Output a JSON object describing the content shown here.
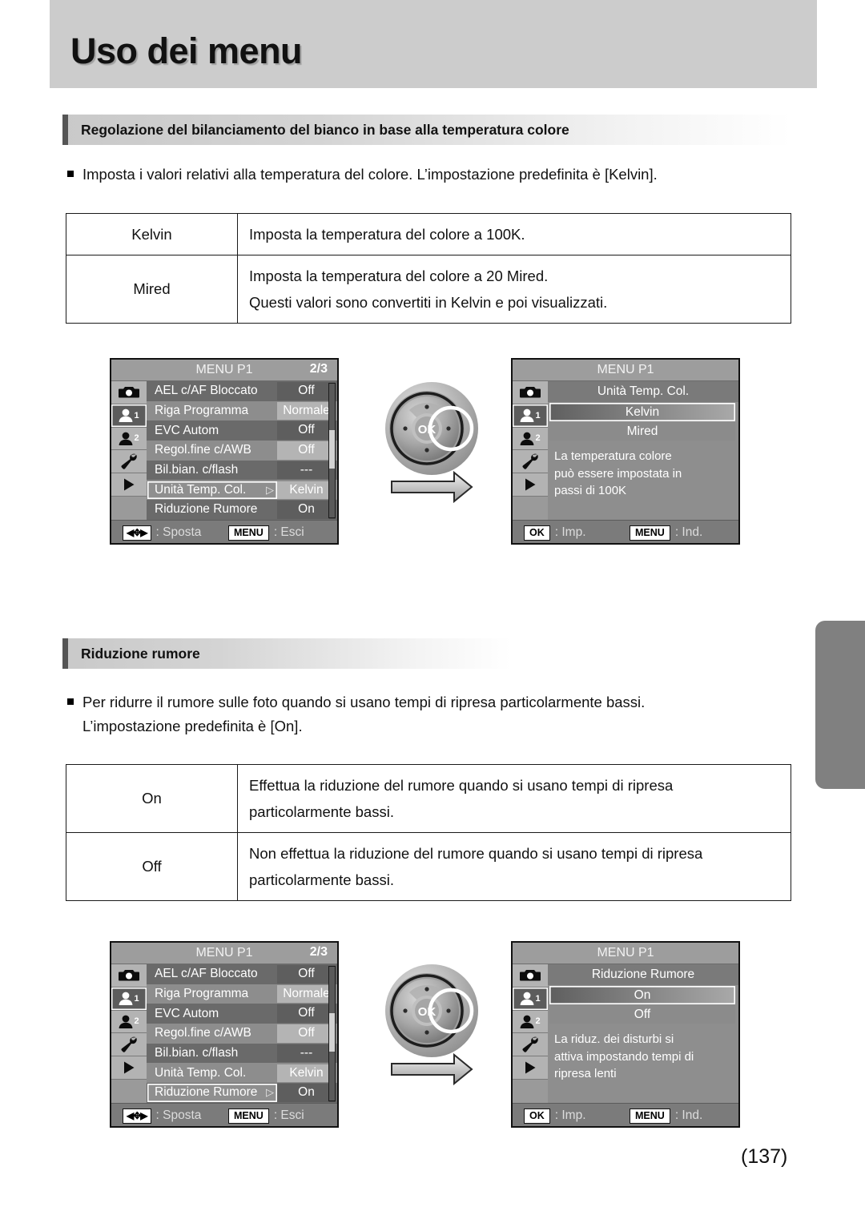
{
  "page": {
    "title": "Uso dei menu",
    "number": "(137)"
  },
  "sections": [
    {
      "heading": "Regolazione del bilanciamento del bianco in base alla temperatura colore",
      "bullet": "Imposta i valori relativi alla temperatura del colore. L’impostazione predefinita è [Kelvin].",
      "table": {
        "rows": [
          {
            "key": "Kelvin",
            "lines": [
              "Imposta la temperatura del colore a 100K."
            ]
          },
          {
            "key": "Mired",
            "lines": [
              "Imposta la temperatura del colore a 20 Mired.",
              "Questi valori sono convertiti in Kelvin e poi visualizzati."
            ]
          }
        ]
      }
    },
    {
      "heading": "Riduzione rumore",
      "bullet_lines": [
        "Per ridurre il rumore sulle foto quando si usano tempi di ripresa particolarmente bassi.",
        "L’impostazione predefinita è [On]."
      ],
      "table": {
        "rows": [
          {
            "key": "On",
            "lines": [
              "Effettua la riduzione del rumore quando si usano tempi di ripresa",
              "particolarmente bassi."
            ]
          },
          {
            "key": "Off",
            "lines": [
              "Non effettua la riduzione del rumore quando si usano tempi di ripresa",
              "particolarmente bassi."
            ]
          }
        ]
      }
    }
  ],
  "lcd_tabs": [
    {
      "icon": "camera-icon",
      "badge": ""
    },
    {
      "icon": "person-icon",
      "badge": "1"
    },
    {
      "icon": "person-icon",
      "badge": "2"
    },
    {
      "icon": "wrench-icon",
      "badge": ""
    },
    {
      "icon": "play-icon",
      "badge": ""
    }
  ],
  "screens": {
    "menu_wb": {
      "title": "MENU P1",
      "page_indicator": "2/3",
      "rows": [
        {
          "label": "AEL c/AF Bloccato",
          "value": "Off",
          "chip": "dark"
        },
        {
          "label": "Riga Programma",
          "value": "Normale",
          "chip": "light"
        },
        {
          "label": "EVC Autom",
          "value": "Off",
          "chip": "dark"
        },
        {
          "label": "Regol.fine c/AWB",
          "value": "Off",
          "chip": "light"
        },
        {
          "label": "Bil.bian. c/flash",
          "value": "---",
          "chip": "dark"
        },
        {
          "label": "Unità Temp. Col.",
          "value": "Kelvin",
          "chip": "light",
          "selected": true
        },
        {
          "label": "Riduzione Rumore",
          "value": "On",
          "chip": "dark"
        }
      ],
      "footer": {
        "key1": "◀✥▶",
        "text1": ": Sposta",
        "key2": "MENU",
        "text2": ": Esci"
      }
    },
    "opt_wb": {
      "title": "MENU P1",
      "option_title": "Unità Temp. Col.",
      "options": [
        {
          "label": "Kelvin",
          "selected": true
        },
        {
          "label": "Mired",
          "selected": false
        }
      ],
      "description": [
        "La temperatura colore",
        "può essere impostata in",
        "passi di 100K"
      ],
      "footer": {
        "key1": "OK",
        "text1": ": Imp.",
        "key2": "MENU",
        "text2": ": Ind."
      }
    },
    "menu_nr": {
      "title": "MENU P1",
      "page_indicator": "2/3",
      "rows": [
        {
          "label": "AEL c/AF Bloccato",
          "value": "Off",
          "chip": "dark"
        },
        {
          "label": "Riga Programma",
          "value": "Normale",
          "chip": "light"
        },
        {
          "label": "EVC Autom",
          "value": "Off",
          "chip": "dark"
        },
        {
          "label": "Regol.fine c/AWB",
          "value": "Off",
          "chip": "light"
        },
        {
          "label": "Bil.bian. c/flash",
          "value": "---",
          "chip": "dark"
        },
        {
          "label": "Unità Temp. Col.",
          "value": "Kelvin",
          "chip": "light"
        },
        {
          "label": "Riduzione Rumore",
          "value": "On",
          "chip": "dark",
          "selected": true
        }
      ],
      "footer": {
        "key1": "◀✥▶",
        "text1": ": Sposta",
        "key2": "MENU",
        "text2": ": Esci"
      }
    },
    "opt_nr": {
      "title": "MENU P1",
      "option_title": "Riduzione Rumore",
      "options": [
        {
          "label": "On",
          "selected": true
        },
        {
          "label": "Off",
          "selected": false
        }
      ],
      "description": [
        "La riduz. dei disturbi si",
        "attiva impostando tempi di",
        "ripresa lenti"
      ],
      "footer": {
        "key1": "OK",
        "text1": ": Imp.",
        "key2": "MENU",
        "text2": ": Ind."
      }
    }
  },
  "dial": {
    "ok_label": "OK",
    "direction": "right"
  }
}
